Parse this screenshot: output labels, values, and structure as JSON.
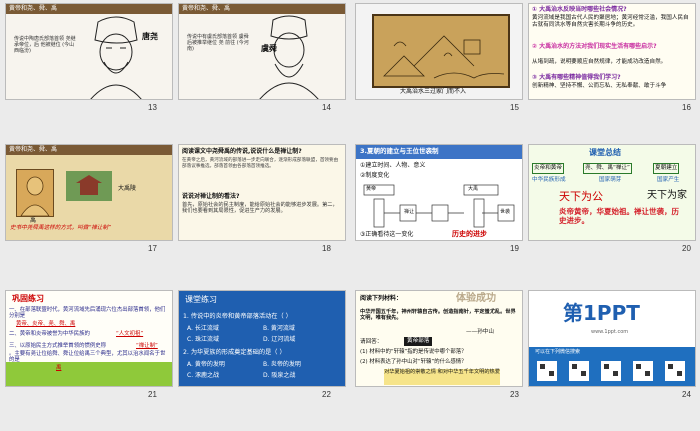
{
  "slides": [
    {
      "number": "13",
      "section": "黄帝和尧、舜、禹",
      "caption": "传说中陶唐氏部落首领 尧继承帝位，后 他被继位 (今山西临汾)",
      "figure_label": "唐尧"
    },
    {
      "number": "14",
      "section": "黄帝和尧、舜、禹",
      "caption": "传说中有虞氏部落首领 虞舜 后被推举继位 尧 前往 (今河南)",
      "figure_label": "虞舜"
    },
    {
      "number": "15",
      "caption": "大禹治水三过家门而不入"
    },
    {
      "number": "16",
      "q1": "① 大禹治水反映当时哪些社会情况?",
      "a1": "黄河流域是我国古代人民的聚居地；黄河经常泛滥，我国人民自古就有同洪水等自然灾害长期斗争的历史。",
      "q2": "② 大禹治水的方法对我们现实生活有哪些启示?",
      "a2": "从堵到疏，说明要顺应自然规律，才能成功改造自然。",
      "q3": "③ 大禹有哪些精神值得我们学习?",
      "a3": "创新精神、坚持不懈、公而忘私、无私奉献、敢于斗争"
    },
    {
      "number": "17",
      "section": "黄帝和尧、舜、禹",
      "figure_label": "禹",
      "place": "大禹陵",
      "caption": "史书中尧舜禹这样的方式，叫做“禅让制”"
    },
    {
      "number": "18",
      "title": "阅读课文中尧舜禹的传说,说说什么是禅让制?",
      "body": "在黄帝之后，黄河流域的部落进一步走向联合，逐渐形成部落联盟，首领要由部落议事推选，部落首领由各部落首领推选。",
      "q": "说说对禅让制的看法?",
      "ans": "首先，原始社会的民主制度，能给原始社会的能够进步发展。第二，我们也要看到其局限性，促进生产力的发展。"
    },
    {
      "number": "19",
      "title": "3.夏朝的建立与王位世袭制",
      "items": [
        "①建立时间、人物、意义",
        "②制度变化",
        "③正确看待这一变化"
      ],
      "diagram": [
        "黄帝",
        "尧",
        "舜",
        "禹",
        "启",
        "大禹",
        "夏",
        "禅让",
        "世袭"
      ],
      "highlight": "历史的进步"
    },
    {
      "number": "20",
      "title": "课堂总结",
      "boxes": [
        "炎帝和黄帝",
        "尧、舜、禹“禅让”",
        "夏朝建立"
      ],
      "subs": [
        "中华民族形成",
        "国家萌芽",
        "国家产生"
      ],
      "calligraphy1": "天下为公",
      "calligraphy2": "天下为家",
      "summary": "炎帝黄帝，华夏始祖。禅让世袭，历史进步。"
    },
    {
      "number": "21",
      "title": "巩固练习",
      "q1": "一、在部落联盟时代，黄河流域先后涌现六位杰出部落首领，他们分别是",
      "fill1": "黄帝、炎帝、尧、舜、禹",
      "q2": "二、黄帝和炎帝被誉为中华民族的",
      "fill2": "“人文初祖”",
      "q3": "三、以原始民主方式推举首领的惯例史称",
      "fill3": "“禅让制”",
      "q3b": "。主要有尧让位给舜、舜让位给禹三个典型，尤其以治水闻名于世的是",
      "fill3b": "禹"
    },
    {
      "number": "22",
      "title": "课堂练习",
      "q1": "1. 传说中的炎帝和黄帝部落活动在（ ）",
      "opts1": [
        "A. 长江流域",
        "B. 黄河流域",
        "C. 珠江流域",
        "D. 辽河流域"
      ],
      "q2": "2. 为华夏族的形成奠定基础的是（ ）",
      "opts2": [
        "A. 黄帝的发明",
        "B. 炎帝的发明",
        "C. 涿鹿之战",
        "D. 阪泉之战"
      ]
    },
    {
      "number": "23",
      "title": "阅读下列材料：",
      "watermark": "体验成功",
      "material": "中华开国五千年，神州轩辕自古传。创造指南针，平定蚩尤乱。世界文明，唯有我先。",
      "author": "——孙中山",
      "ask": "请回答：",
      "label": "黄帝部落",
      "q1": "(1) 材料中的“轩辕”指的是传说中哪个部落？",
      "q2": "(2) 材料表达了孙中山对“轩辕”的什么感情？",
      "answer": "对华夏始祖的崇敬之情 和对中华五千年文明的热爱"
    },
    {
      "number": "24",
      "logo": "第1PPT",
      "logo_sub": "www.1ppt.com",
      "footer": "可以在下列微信搜索"
    }
  ],
  "colors": {
    "grass": "#8fc93a",
    "blue_bg": "#1f5fb0",
    "red": "#d4202a",
    "green_text": "#2a7a2a"
  }
}
